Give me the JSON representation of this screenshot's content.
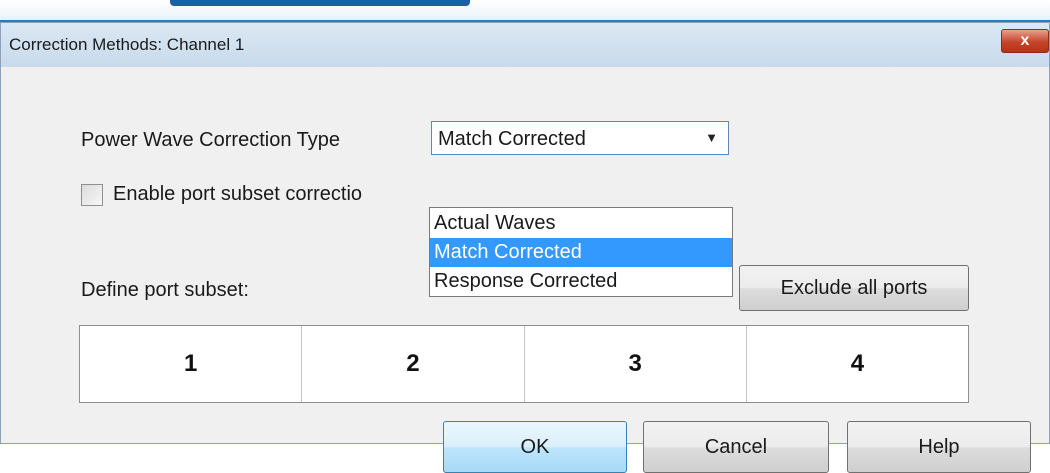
{
  "window": {
    "title": "Correction Methods: Channel 1",
    "close_glyph": "x"
  },
  "power_wave": {
    "label": "Power Wave Correction Type",
    "selected": "Match Corrected",
    "options": [
      "Actual Waves",
      "Match Corrected",
      "Response Corrected"
    ],
    "highlighted_option": "Match Corrected"
  },
  "port_subset_checkbox": {
    "label": "Enable port subset correctio",
    "checked": false
  },
  "define_port_subset": {
    "label": "Define port subset:"
  },
  "exclude_button": {
    "label": "Exclude all ports"
  },
  "ports": [
    "1",
    "2",
    "3",
    "4"
  ],
  "buttons": {
    "ok": "OK",
    "cancel": "Cancel",
    "help": "Help"
  },
  "icons": {
    "dropdown_arrow": "chevron-down-icon",
    "close": "close-icon"
  },
  "colors": {
    "highlight": "#3399ff",
    "close_button": "#c5442a",
    "title_bar": "#d3e2f1"
  }
}
